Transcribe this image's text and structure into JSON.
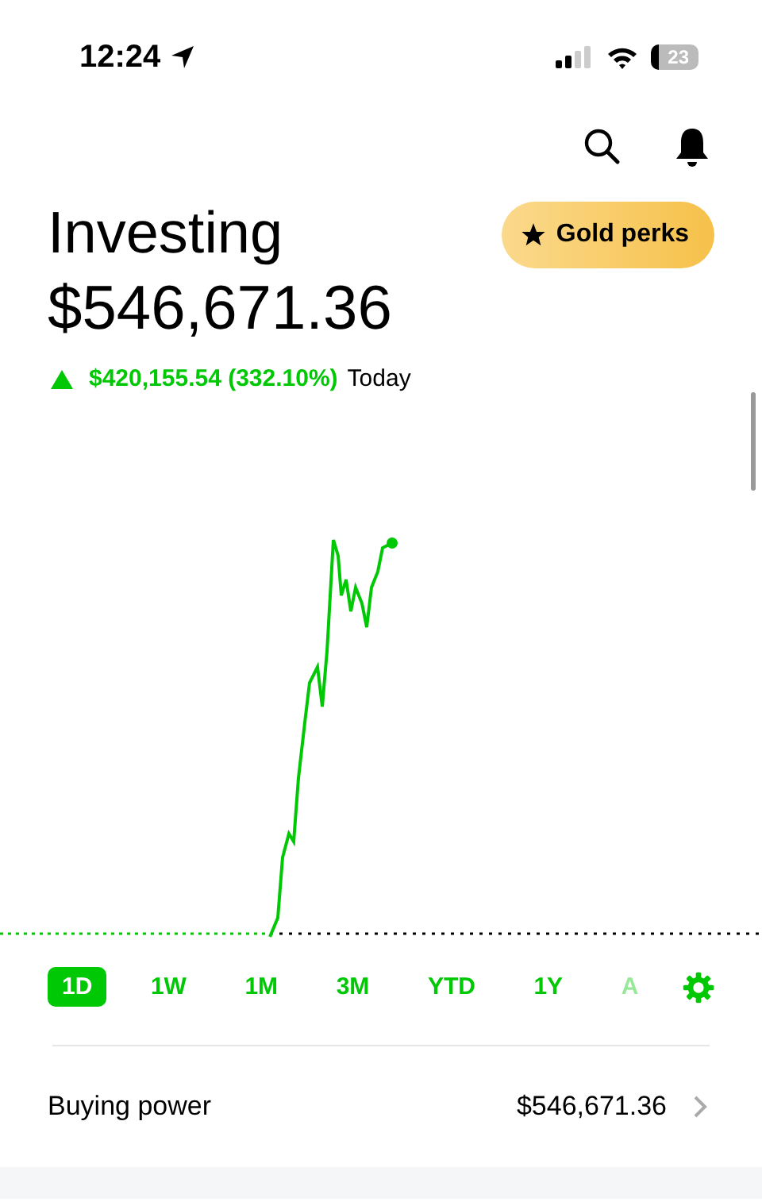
{
  "status_bar": {
    "time": "12:24",
    "battery": "23"
  },
  "header": {
    "title": "Investing",
    "value": "$546,671.36",
    "change": "$420,155.54 (332.10%)",
    "change_period": "Today",
    "gold_button": "Gold perks"
  },
  "ranges": [
    {
      "label": "1D",
      "selected": true
    },
    {
      "label": "1W",
      "selected": false
    },
    {
      "label": "1M",
      "selected": false
    },
    {
      "label": "3M",
      "selected": false
    },
    {
      "label": "YTD",
      "selected": false
    },
    {
      "label": "1Y",
      "selected": false
    },
    {
      "label": "A",
      "selected": false
    }
  ],
  "buying_power": {
    "label": "Buying power",
    "value": "$546,671.36"
  }
}
